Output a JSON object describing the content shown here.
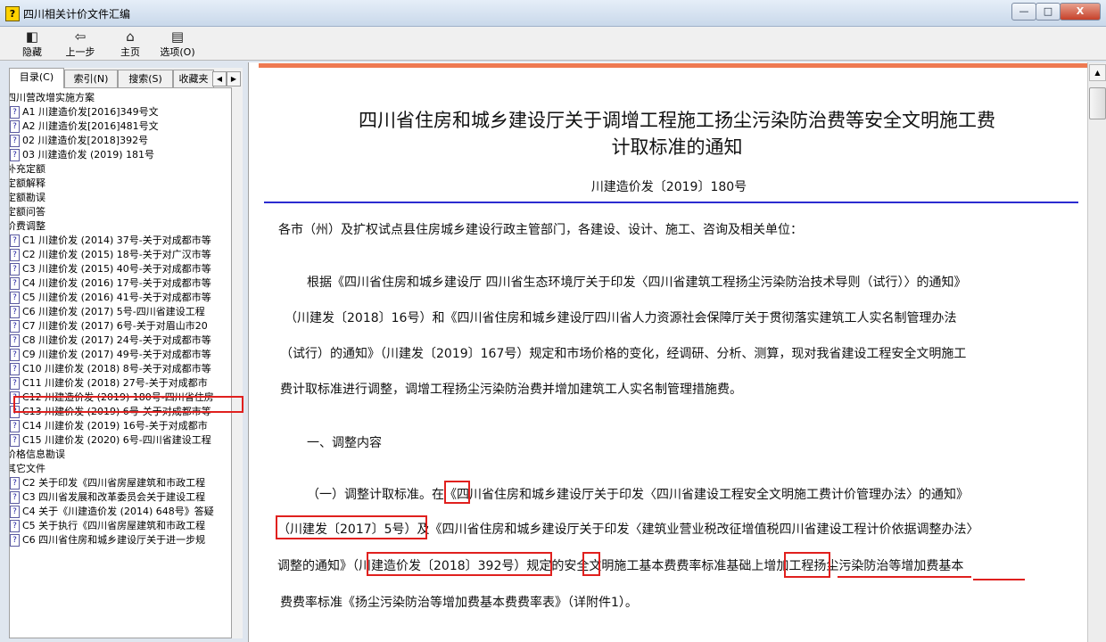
{
  "window": {
    "title": "四川相关计价文件汇编",
    "app_icon": "?",
    "buttons": {
      "minimize": "—",
      "maximize": "□",
      "close": "X"
    }
  },
  "toolbar": {
    "hide": {
      "label": "隐藏",
      "icon": "hide-pane-icon"
    },
    "back": {
      "label": "上一步",
      "icon": "back-arrow-icon"
    },
    "home": {
      "label": "主页",
      "icon": "home-icon"
    },
    "options": {
      "label": "选项(O)",
      "icon": "options-icon"
    }
  },
  "tabs": [
    "目录(C)",
    "索引(N)",
    "搜索(S)",
    "收藏夹"
  ],
  "tree": [
    {
      "label": "四川营改增实施方案",
      "icon": false
    },
    {
      "label": "A1 川建造价发[2016]349号文",
      "icon": true
    },
    {
      "label": "A2 川建造价发[2016]481号文",
      "icon": true
    },
    {
      "label": "02 川建造价发[2018]392号",
      "icon": true
    },
    {
      "label": "03 川建造价发 (2019) 181号",
      "icon": true
    },
    {
      "label": "补充定额",
      "icon": false
    },
    {
      "label": "定额解释",
      "icon": false
    },
    {
      "label": "定额勘误",
      "icon": false
    },
    {
      "label": "定额问答",
      "icon": false
    },
    {
      "label": "价费调整",
      "icon": false
    },
    {
      "label": "C1 川建价发 (2014) 37号-关于对成都市等",
      "icon": true
    },
    {
      "label": "C2 川建价发 (2015) 18号-关于对广汉市等",
      "icon": true
    },
    {
      "label": "C3 川建价发 (2015) 40号-关于对成都市等",
      "icon": true
    },
    {
      "label": "C4 川建价发 (2016) 17号-关于对成都市等",
      "icon": true
    },
    {
      "label": "C5 川建价发 (2016) 41号-关于对成都市等",
      "icon": true
    },
    {
      "label": "C6 川建价发 (2017) 5号-四川省建设工程",
      "icon": true
    },
    {
      "label": "C7 川建价发 (2017) 6号-关于对眉山市20",
      "icon": true
    },
    {
      "label": "C8 川建价发 (2017) 24号-关于对成都市等",
      "icon": true
    },
    {
      "label": "C9 川建价发 (2017) 49号-关于对成都市等",
      "icon": true
    },
    {
      "label": "C10 川建价发 (2018) 8号-关于对成都市等",
      "icon": true
    },
    {
      "label": "C11 川建价发 (2018) 27号-关于对成都市",
      "icon": true
    },
    {
      "label": "C12 川建造价发 (2019) 180号-四川省住房",
      "icon": true
    },
    {
      "label": "C13 川建价发 (2019) 6号-关于对成都市等",
      "icon": true
    },
    {
      "label": "C14 川建价发 (2019) 16号-关于对成都市",
      "icon": true
    },
    {
      "label": "C15 川建价发 (2020) 6号-四川省建设工程",
      "icon": true
    },
    {
      "label": "价格信息勘误",
      "icon": false
    },
    {
      "label": "其它文件",
      "icon": false
    },
    {
      "label": "C2 关于印发《四川省房屋建筑和市政工程",
      "icon": true
    },
    {
      "label": "C3 四川省发展和改革委员会关于建设工程",
      "icon": true
    },
    {
      "label": "C4 关于《川建造价发 (2014) 648号》答疑",
      "icon": true
    },
    {
      "label": "C5 关于执行《四川省房屋建筑和市政工程",
      "icon": true
    },
    {
      "label": "C6 四川省住房和城乡建设厅关于进一步规",
      "icon": true
    }
  ],
  "document": {
    "title_line1": "四川省住房和城乡建设厅关于调增工程施工扬尘污染防治费等安全文明施工费",
    "title_line2": "计取标准的通知",
    "number": "川建造价发〔2019〕180号",
    "addressee": "各市（州）及扩权试点县住房城乡建设行政主管部门，各建设、设计、施工、咨询及相关单位：",
    "p1": [
      "根据《四川省住房和城乡建设厅 四川省生态环境厅关于印发〈四川省建筑工程扬尘污染防治技术导则（试行）〉的通知》",
      "（川建发〔2018〕16号）和《四川省住房和城乡建设厅四川省人力资源社会保障厅关于贯彻落实建筑工人实名制管理办法",
      "（试行）的通知》（川建发〔2019〕167号）规定和市场价格的变化，经调研、分析、测算，现对我省建设工程安全文明施工",
      "费计取标准进行调整，调增工程扬尘污染防治费并增加建筑工人实名制管理措施费。"
    ],
    "section1": "一、调整内容",
    "p2": [
      "（一）调整计取标准。在《四川省住房和城乡建设厅关于印发〈四川省建设工程安全文明施工费计价管理办法〉的通知》",
      "（川建发〔2017〕5号）及《四川省住房和城乡建设厅关于印发〈建筑业营业税改征增值税四川省建设工程计价依据调整办法〉",
      "调整的通知》（川建造价发〔2018〕392号）规定的安全文明施工基本费费率标准基础上增加工程扬尘污染防治等增加费基本",
      "费费率标准《扬尘污染防治等增加费基本费费率表》（详附件1）。"
    ]
  },
  "annotation_color": "#e0201e"
}
